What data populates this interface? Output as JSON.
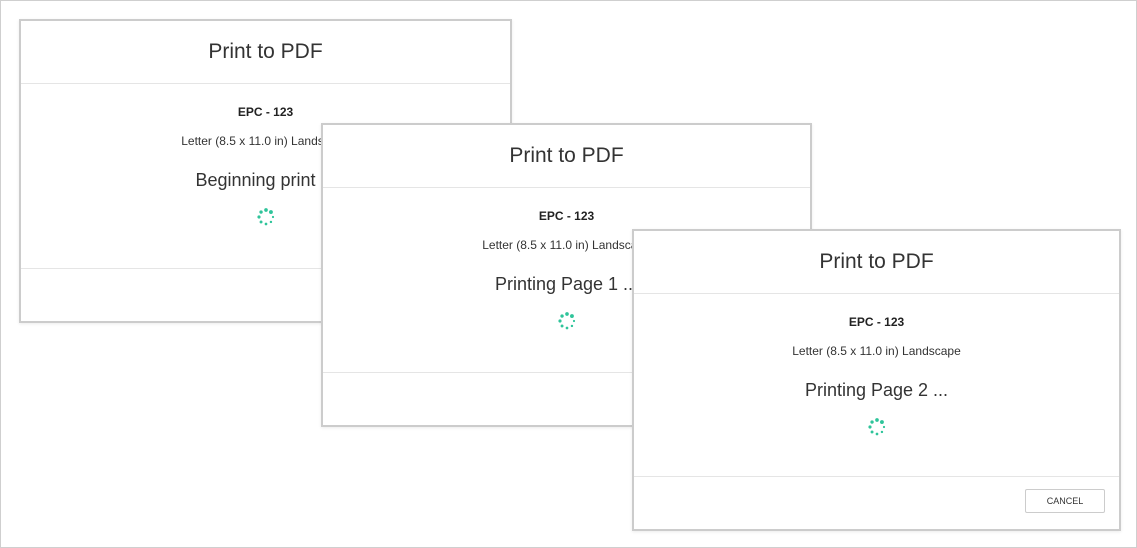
{
  "colors": {
    "spinner": "#2fc49a",
    "border": "#cccccc"
  },
  "dialogs": [
    {
      "title": "Print to PDF",
      "doc_name": "EPC - 123",
      "paper": "Letter (8.5 x 11.0 in) Landscape",
      "status": "Beginning print ..."
    },
    {
      "title": "Print to PDF",
      "doc_name": "EPC - 123",
      "paper": "Letter (8.5 x 11.0 in) Landscape",
      "status": "Printing Page 1 ..."
    },
    {
      "title": "Print to PDF",
      "doc_name": "EPC - 123",
      "paper": "Letter (8.5 x 11.0 in) Landscape",
      "status": "Printing Page 2 ...",
      "cancel_label": "CANCEL"
    }
  ]
}
